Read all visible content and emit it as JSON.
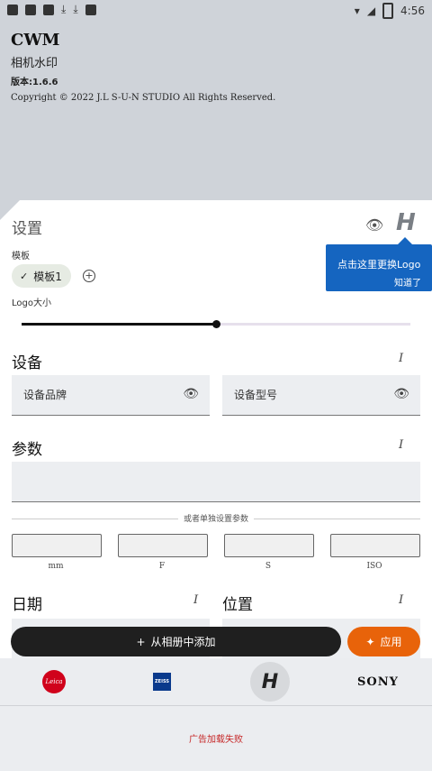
{
  "status": {
    "time": "4:56"
  },
  "header": {
    "title": "CWM",
    "subtitle": "相机水印",
    "version": "版本:1.6.6",
    "copyright": "Copyright © 2022 J.L S-U-N STUDIO All Rights Reserved."
  },
  "settings": {
    "title": "设置",
    "logo_letter": "H",
    "tooltip": {
      "text": "点击这里更换Logo",
      "ok": "知道了"
    },
    "template_label": "模板",
    "template_chip": "模板1",
    "logo_size_label": "Logo大小",
    "logo_size_value": 0.5
  },
  "device": {
    "title": "设备",
    "brand_placeholder": "设备品牌",
    "model_placeholder": "设备型号"
  },
  "params": {
    "title": "参数",
    "divider": "或者单独设置参数",
    "labels": [
      "mm",
      "F",
      "S",
      "ISO"
    ]
  },
  "date": {
    "title": "日期"
  },
  "location": {
    "title": "位置"
  },
  "actions": {
    "add_label": "从相册中添加",
    "apply_label": "应用"
  },
  "brands": [
    "Leica",
    "ZEISS",
    "H",
    "SONY"
  ],
  "ad": {
    "text": "广告加载失败"
  },
  "colors": {
    "accent": "#e8630a",
    "tooltip": "#1565c0",
    "error": "#c62828"
  }
}
